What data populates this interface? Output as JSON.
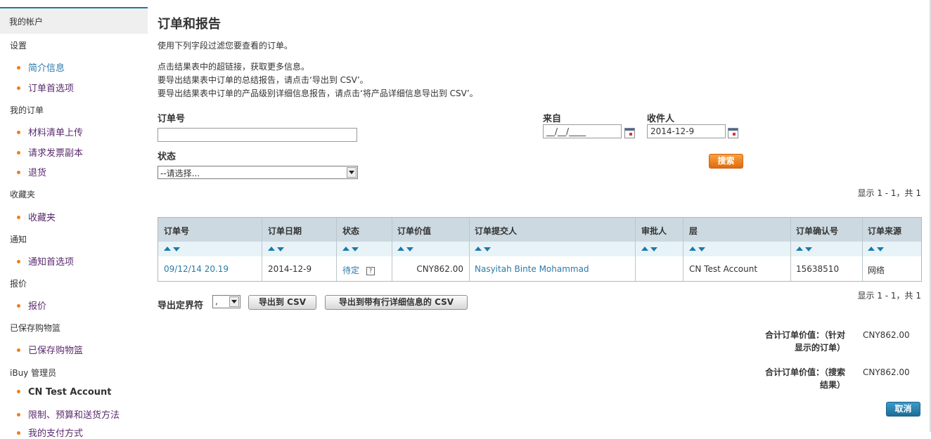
{
  "sidebar": {
    "account": "我的帐户",
    "sections": [
      {
        "heading": "设置",
        "items": [
          {
            "label": "简介信息"
          },
          {
            "label": "订单首选项"
          }
        ]
      },
      {
        "heading": "我的订单",
        "items": [
          {
            "label": "材料清单上传"
          },
          {
            "label": "请求发票副本"
          },
          {
            "label": "退货"
          }
        ]
      },
      {
        "heading": "收藏夹",
        "items": [
          {
            "label": "收藏夹"
          }
        ]
      },
      {
        "heading": "通知",
        "items": [
          {
            "label": "通知首选项"
          }
        ]
      },
      {
        "heading": "报价",
        "items": [
          {
            "label": "报价"
          }
        ]
      },
      {
        "heading": "已保存购物篮",
        "items": [
          {
            "label": "已保存购物篮"
          }
        ]
      },
      {
        "heading": "iBuy 管理员",
        "items": [
          {
            "label": "CN Test Account"
          },
          {
            "label": "限制、预算和送货方法"
          },
          {
            "label": "我的支付方式"
          }
        ]
      }
    ]
  },
  "page": {
    "title": "订单和报告",
    "intro": "使用下列字段过滤您要查看的订单。",
    "help1": "点击结果表中的超链接，获取更多信息。",
    "help2": "要导出结果表中订单的总结报告，请点击‘导出到 CSV’。",
    "help3": "要导出结果表中订单的产品级别详细信息报告，请点击‘将产品详细信息导出到 CSV’。"
  },
  "filters": {
    "order_no_label": "订单号",
    "order_no_value": "",
    "status_label": "状态",
    "status_value": "--请选择...",
    "from_label": "来自",
    "from_value": "__/__/____",
    "to_label": "收件人",
    "to_value": "2014-12-9",
    "search_label": "搜索"
  },
  "results": {
    "count_top": "显示 1 - 1，共 1",
    "count_bottom": "显示 1 - 1，共 1",
    "columns": [
      "订单号",
      "订单日期",
      "状态",
      "订单价值",
      "订单提交人",
      "审批人",
      "层",
      "订单确认号",
      "订单来源"
    ],
    "rows": [
      {
        "order_no": "09/12/14 20.19",
        "date": "2014-12-9",
        "status": "待定",
        "value": "CNY862.00",
        "submitter": "Nasyitah Binte Mohammad",
        "approver": "",
        "tier": "CN Test Account",
        "confirm_no": "15638510",
        "source": "网络"
      }
    ]
  },
  "export": {
    "delimiter_label": "导出定界符",
    "delimiter_value": ",",
    "csv_label": "导出到 CSV",
    "csv_detail_label": "导出到带有行详细信息的 CSV"
  },
  "totals": {
    "shown_label_1": "合计订单价值：（针对",
    "shown_label_2": "显示的订单）",
    "shown_value": "CNY862.00",
    "search_label_1": "合计订单价值：（搜索",
    "search_label_2": "结果）",
    "search_value": "CNY862.00"
  },
  "cancel_label": "取消"
}
